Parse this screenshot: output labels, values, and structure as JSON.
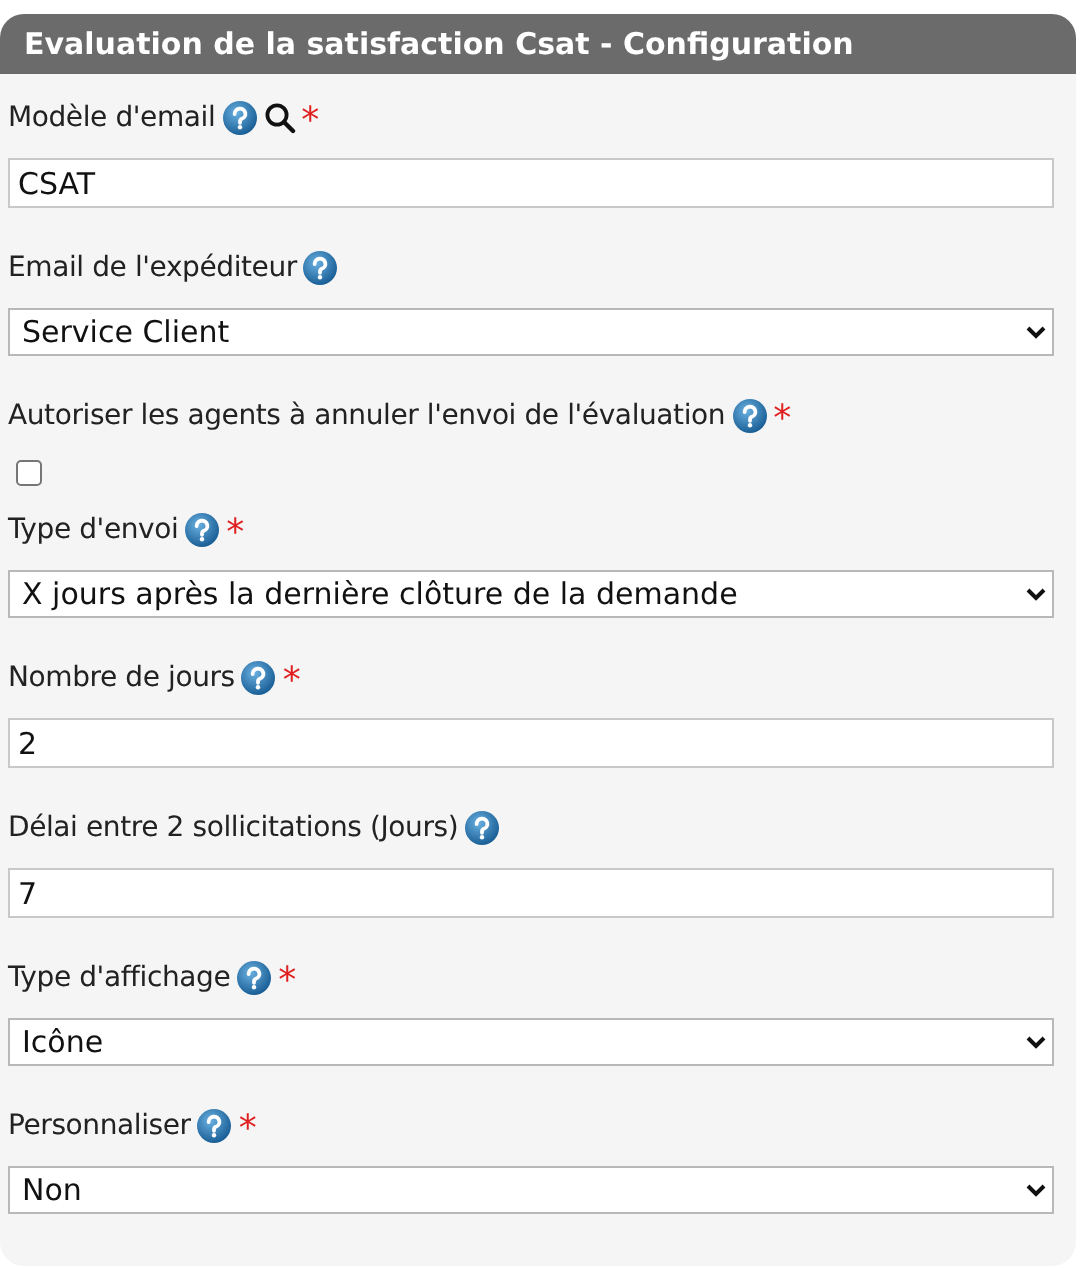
{
  "panel": {
    "title": "Evaluation de la satisfaction Csat - Configuration"
  },
  "fields": [
    {
      "kind": "text",
      "label": "Modèle d'email",
      "required_mark": "*",
      "lookup": true,
      "value": "CSAT"
    },
    {
      "kind": "select",
      "label": "Email de l'expéditeur",
      "lookup": false,
      "value": "Service Client"
    },
    {
      "kind": "checkbox",
      "label": "Autoriser les agents à annuler l'envoi de l'évaluation",
      "required_mark": "*",
      "lookup": false,
      "checked": false
    },
    {
      "kind": "select",
      "label": "Type d'envoi",
      "required_mark": "*",
      "lookup": false,
      "value": "X jours après la dernière clôture de la demande"
    },
    {
      "kind": "text",
      "label": "Nombre de jours",
      "required_mark": "*",
      "lookup": false,
      "value": "2"
    },
    {
      "kind": "text",
      "label": "Délai entre 2 sollicitations (Jours)",
      "lookup": false,
      "value": "7"
    },
    {
      "kind": "select",
      "label": "Type d'affichage",
      "required_mark": "*",
      "lookup": false,
      "value": "Icône"
    },
    {
      "kind": "select",
      "label": "Personnaliser",
      "required_mark": "*",
      "lookup": false,
      "value": "Non"
    }
  ]
}
